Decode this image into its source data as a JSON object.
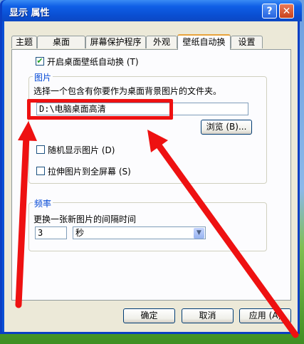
{
  "window": {
    "title": "显示 属性",
    "help_glyph": "?",
    "close_glyph": "✕"
  },
  "tabs": [
    {
      "label": "主题"
    },
    {
      "label": "桌面"
    },
    {
      "label": "屏幕保护程序"
    },
    {
      "label": "外观"
    },
    {
      "label": "壁纸自动换",
      "active": true
    },
    {
      "label": "设置"
    }
  ],
  "auto_wallpaper": {
    "label": "开启桌面壁纸自动换 (T)",
    "checked": true
  },
  "pictures_group": {
    "title": "图片",
    "description": "选择一个包含有你要作为桌面背景图片的文件夹。",
    "folder_path": "D:\\电脑桌面高清",
    "browse_label": "浏览 (B)...",
    "random_label": "随机显示图片 (D)",
    "random_checked": false,
    "stretch_label": "拉伸图片到全屏幕 (S)",
    "stretch_checked": false
  },
  "frequency_group": {
    "title": "频率",
    "description": "更换一张新图片的间隔时间",
    "interval_value": "3",
    "unit_value": "秒"
  },
  "footer": {
    "ok_label": "确定",
    "cancel_label": "取消",
    "apply_label": "应用 (A)"
  },
  "annotations": {
    "highlight_color": "#ee1111",
    "arrow_color": "#ee1111"
  }
}
